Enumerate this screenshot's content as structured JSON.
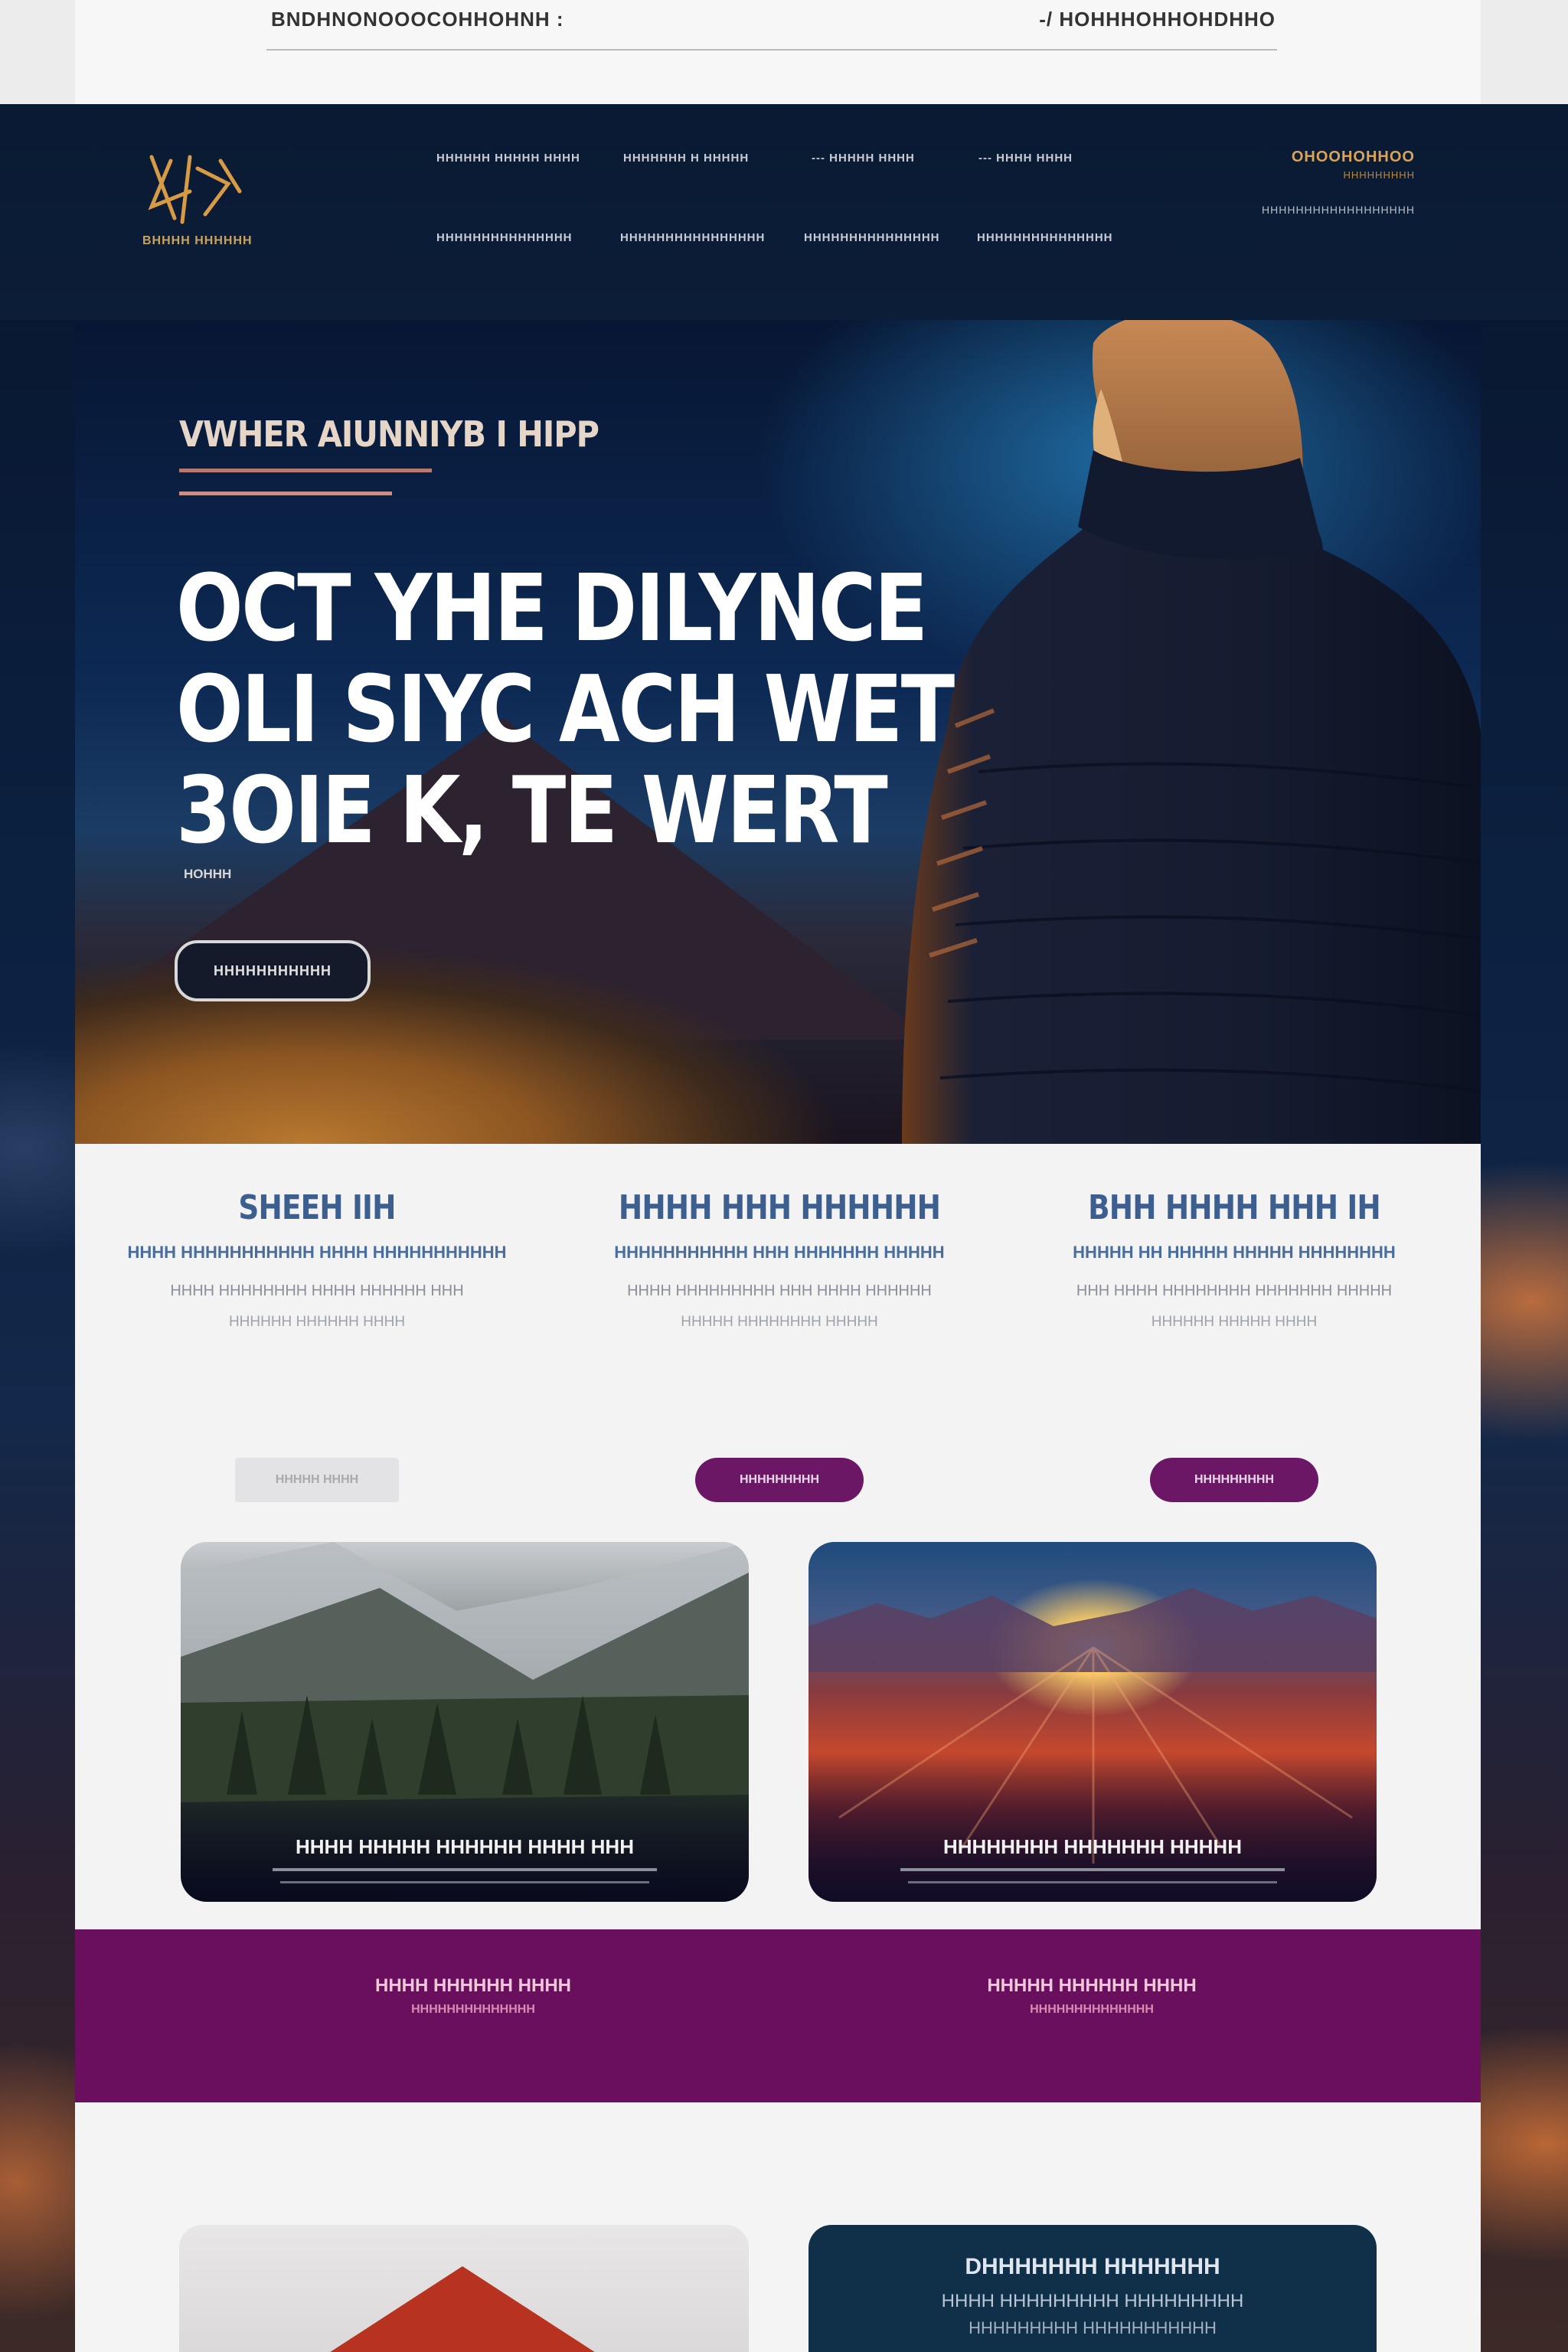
{
  "top_strip": {
    "left_text": "BNDHNONOOOCOHHOHNH :",
    "right_text": "-/ HOHHHOHHOHDHHO"
  },
  "header": {
    "logo_sub": "BHHHH HHHHHH",
    "nav_row1": [
      "HHHHHH HHHHH HHHH",
      "HHHHHHH H HHHHH",
      "--- HHHHH HHHH",
      "--- HHHH HHHH"
    ],
    "nav_row2": [
      "HHHHHHHHHHHHHHH",
      "HHHHHHHHHHHHHHHH",
      "HHHHHHHHHHHHHHH",
      "HHHHHHHHHHHHHHH"
    ],
    "cta_line1": "OHOOHOHHOO",
    "cta_line2": "HHHHHHHHH",
    "cta_line3": "HHHHHHHHHHHHHHHHHH"
  },
  "hero": {
    "eyebrow": "VWHER AIUNNIYB I HIPP",
    "headline": [
      "OCT YHE DILYNCE",
      "OLI SIYC ACH WET",
      "3OIE K, TE WERT"
    ],
    "tag": "HOHHH",
    "button": "HHHHHHHHHHH"
  },
  "features": [
    {
      "title": "SHEEH IIH",
      "subtitle": "HHHH HHHHHHHHHHH HHHH HHHHHHHHHHH",
      "body1": "HHHH HHHHHHHH HHHH HHHHHH HHH",
      "body2": "HHHHHH HHHHHH HHHH",
      "button": "HHHHH HHHH",
      "button_style": "ghost"
    },
    {
      "title": "HHHH HHH HHHHHH",
      "subtitle": "HHHHHHHHHHH HHH HHHHHHH HHHHH",
      "body1": "HHHH HHHHHHHHH HHH HHHH HHHHHH",
      "body2": "HHHHH HHHHHHHH HHHHH",
      "button": "HHHHHHHHH",
      "button_style": "filled"
    },
    {
      "title": "BHH HHHH HHH IH",
      "subtitle": "HHHHH HH HHHHH HHHHH HHHHHHHH",
      "body1": "HHH HHHH HHHHHHHH HHHHHHH HHHHH",
      "body2": "HHHHHH HHHHH HHHH",
      "button": "HHHHHHHHH",
      "button_style": "filled"
    }
  ],
  "cards": [
    {
      "caption": "HHHH HHHHH HHHHHH HHHH HHH"
    },
    {
      "caption": "HHHHHHHH HHHHHHH HHHHH"
    }
  ],
  "band": [
    {
      "title": "HHHH HHHHHH HHHH",
      "sub": "HHHHHHHHHHHHHH"
    },
    {
      "title": "HHHHH HHHHHH HHHH",
      "sub": "HHHHHHHHHHHHHH"
    }
  ],
  "bottom_card": {
    "line1": "DHHHHHHH HHHHHHH",
    "line2": "HHHH HHHHHHHHH HHHHHHHHH",
    "line3": "HHHHHHHHH HHHHHHHHHHH"
  },
  "colors": {
    "accent_purple": "#6a0f5e",
    "nav_bg": "#0a1a33",
    "heading_blue": "#3c5f8f",
    "gold": "#d9a35a"
  }
}
